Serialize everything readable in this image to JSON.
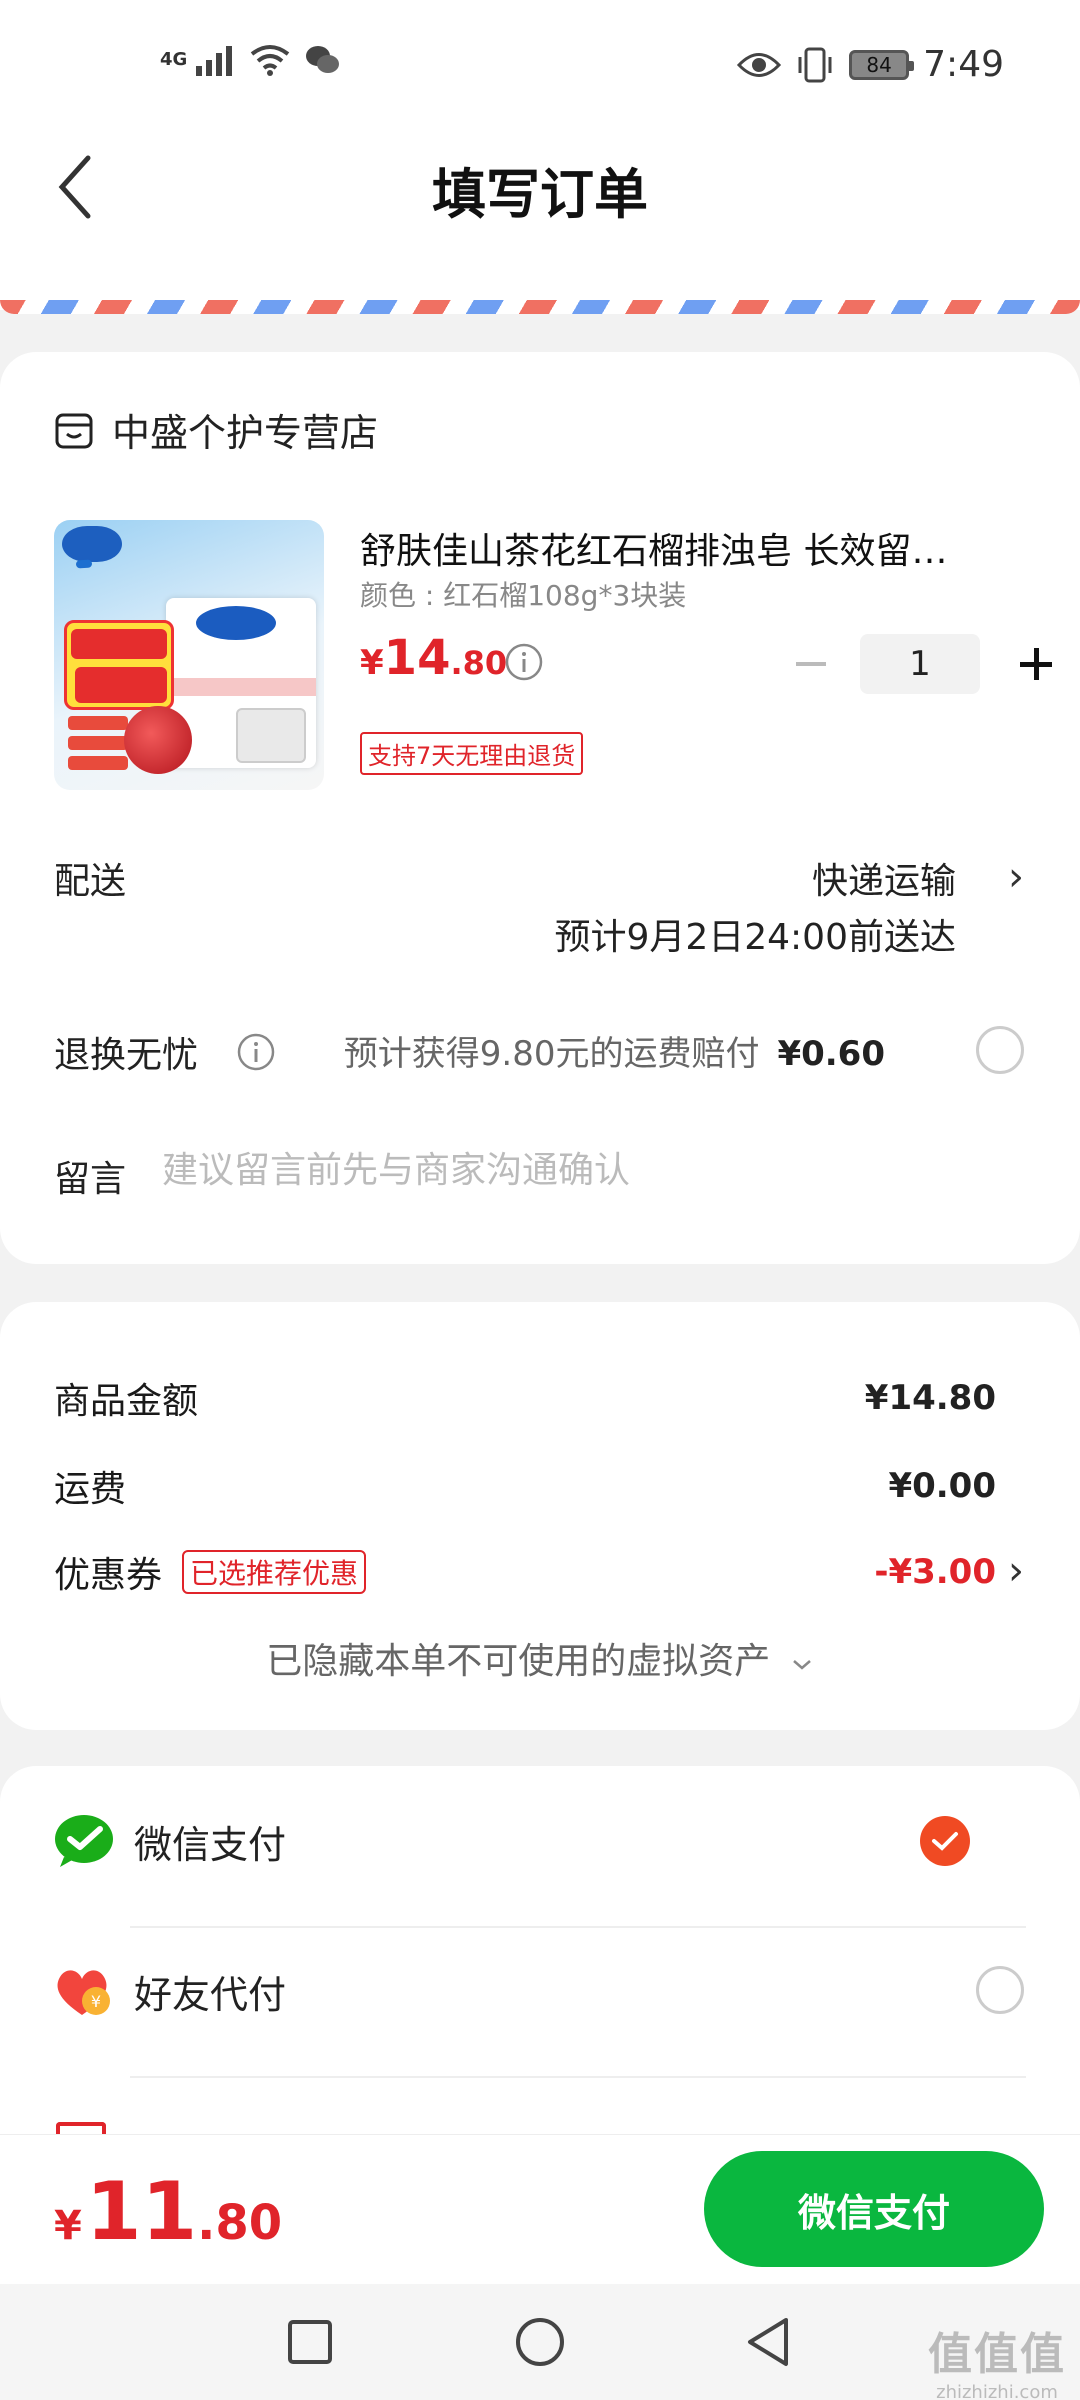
{
  "status_bar": {
    "network": "4G",
    "time": "7:49",
    "battery": "84"
  },
  "header": {
    "title": "填写订单"
  },
  "store": {
    "name": "中盛个护专营店"
  },
  "product": {
    "title": "舒肤佳山茶花红石榴排浊皂 长效留…",
    "spec": "颜色 : 红石榴108g*3块装",
    "price_symbol": "¥",
    "price_integer": "14",
    "price_decimal": ".80",
    "quantity": "1",
    "return_tag": "支持7天无理由退货"
  },
  "delivery": {
    "label": "配送",
    "method": "快递运输",
    "eta": "预计9月2日24:00前送达"
  },
  "return_insurance": {
    "label": "退换无忧",
    "text": "预计获得9.80元的运费赔付",
    "amount": "¥0.60"
  },
  "message": {
    "label": "留言",
    "placeholder": "建议留言前先与商家沟通确认"
  },
  "summary": {
    "goods_label": "商品金额",
    "goods_value": "¥14.80",
    "shipping_label": "运费",
    "shipping_value": "¥0.00",
    "coupon_label": "优惠券",
    "coupon_tag": "已选推荐优惠",
    "coupon_value": "-¥3.00",
    "hidden_assets": "已隐藏本单不可使用的虚拟资产"
  },
  "payment": {
    "methods": [
      {
        "label": "微信支付",
        "selected": true
      },
      {
        "label": "好友代付",
        "selected": false
      }
    ]
  },
  "bottom": {
    "total_symbol": "¥",
    "total_integer": "11",
    "total_decimal": ".80",
    "pay_button": "微信支付"
  },
  "watermark": {
    "main": "值值值",
    "sub": "zhizhizhi.com"
  },
  "colors": {
    "accent_red": "#e0242a",
    "wechat_green": "#0ab73f",
    "check_orange": "#f04a23"
  }
}
